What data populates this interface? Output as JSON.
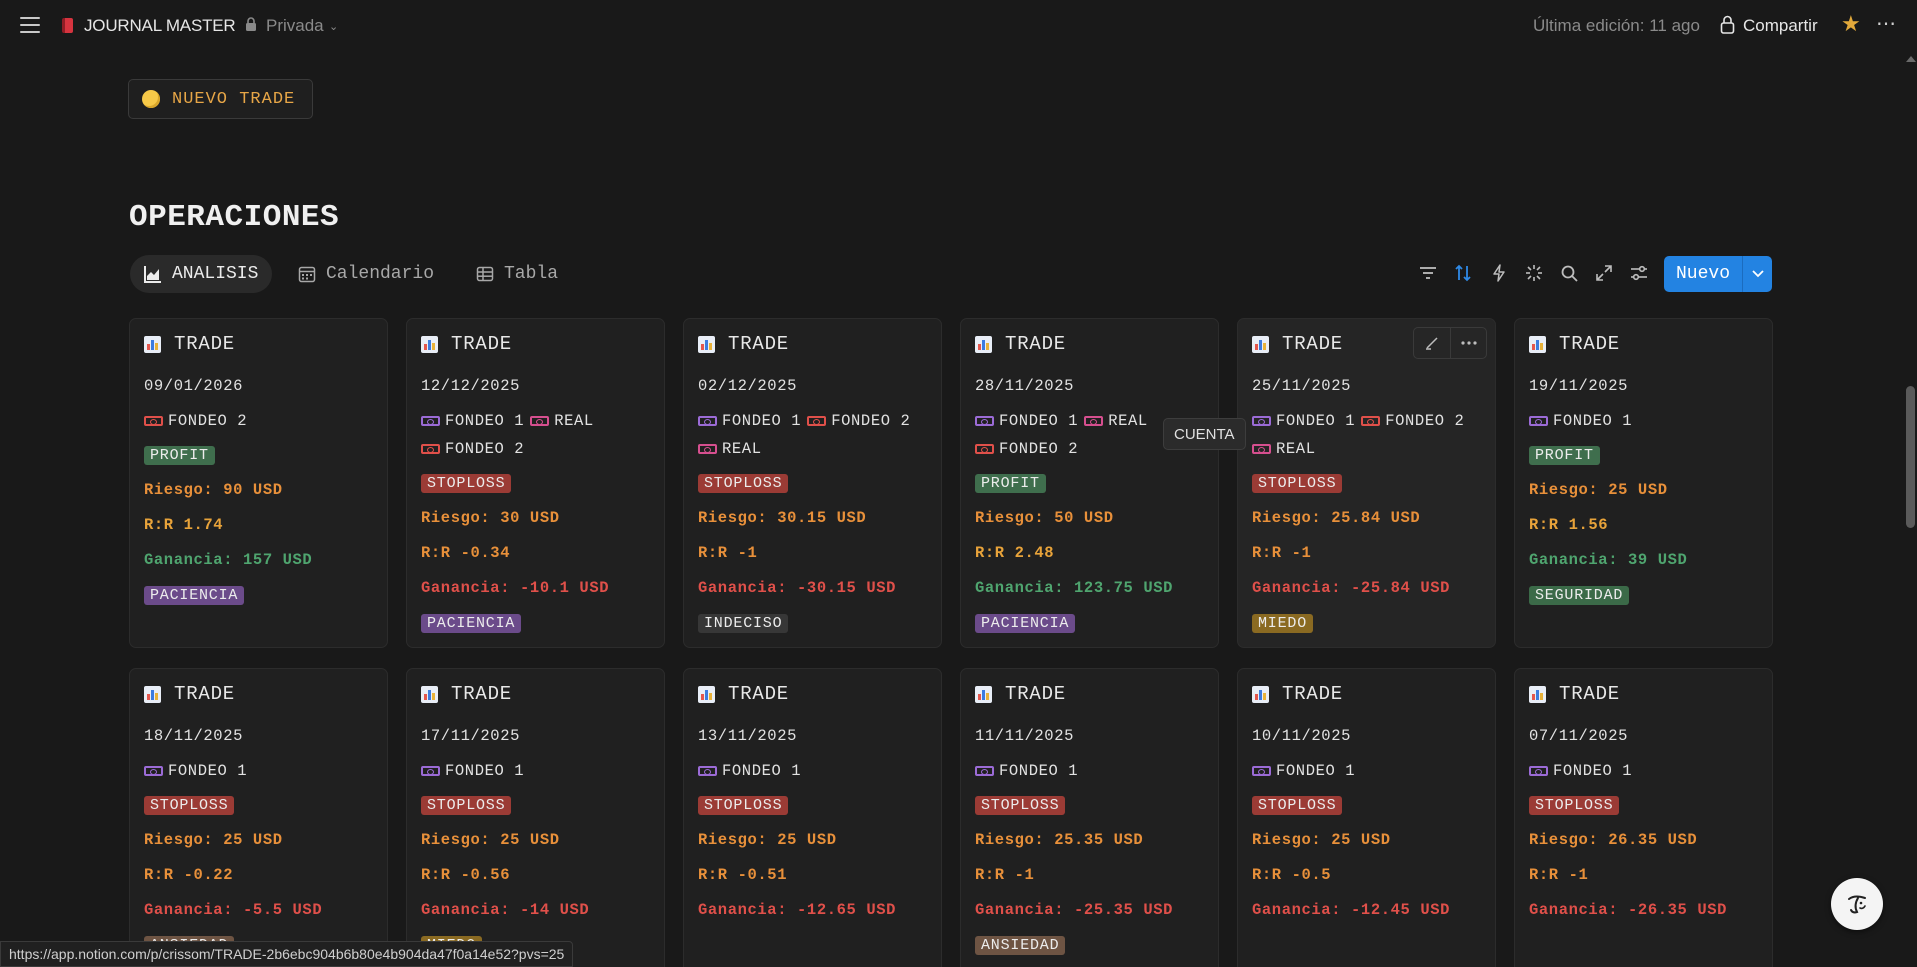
{
  "topbar": {
    "title": "JOURNAL MASTER",
    "privacy": "Privada",
    "last_edit": "Última edición: 11 ago",
    "share": "Compartir"
  },
  "new_trade_button": "NUEVO TRADE",
  "section_title": "OPERACIONES",
  "tabs": [
    {
      "label": "ANALISIS",
      "active": true
    },
    {
      "label": "Calendario",
      "active": false
    },
    {
      "label": "Tabla",
      "active": false
    }
  ],
  "toolbar": {
    "new_label": "Nuevo"
  },
  "tooltip": "CUENTA",
  "status_url": "https://app.notion.com/p/crissom/TRADE-2b6ebc904b6b80e4b904da47f0a14e52?pvs=25",
  "colors": {
    "profit": "#3f6e4d",
    "stoploss": "#9b3b35",
    "paciencia": "#6b4b8a",
    "indeciso": "#373737",
    "miedo": "#8a6a22",
    "seguridad": "#3b6a48",
    "ansiedad": "#6e5443",
    "account_purple": "#9b6bd6",
    "account_red": "#e0504a",
    "account_pink": "#d64f8f",
    "accent_blue": "#2383e2"
  },
  "cards": [
    {
      "title": "TRADE",
      "date": "09/01/2026",
      "accounts": [
        {
          "name": "FONDEO 2",
          "color": "red"
        }
      ],
      "result": "PROFIT",
      "riesgo": "Riesgo: 90 USD",
      "rr": "R:R 1.74",
      "ganancia": "Ganancia: 157 USD",
      "gain_positive": true,
      "emotion": "PACIENCIA"
    },
    {
      "title": "TRADE",
      "date": "12/12/2025",
      "accounts": [
        {
          "name": "FONDEO 1",
          "color": "purple"
        },
        {
          "name": "REAL",
          "color": "pink"
        },
        {
          "name": "FONDEO 2",
          "color": "red"
        }
      ],
      "result": "STOPLOSS",
      "riesgo": "Riesgo: 30 USD",
      "rr": "R:R -0.34",
      "ganancia": "Ganancia: -10.1 USD",
      "gain_positive": false,
      "emotion": "PACIENCIA"
    },
    {
      "title": "TRADE",
      "date": "02/12/2025",
      "accounts": [
        {
          "name": "FONDEO 1",
          "color": "purple"
        },
        {
          "name": "FONDEO 2",
          "color": "red"
        },
        {
          "name": "REAL",
          "color": "pink"
        }
      ],
      "result": "STOPLOSS",
      "riesgo": "Riesgo: 30.15 USD",
      "rr": "R:R -1",
      "ganancia": "Ganancia: -30.15 USD",
      "gain_positive": false,
      "emotion": "INDECISO"
    },
    {
      "title": "TRADE",
      "date": "28/11/2025",
      "accounts": [
        {
          "name": "FONDEO 1",
          "color": "purple"
        },
        {
          "name": "REAL",
          "color": "pink"
        },
        {
          "name": "FONDEO 2",
          "color": "red"
        }
      ],
      "result": "PROFIT",
      "riesgo": "Riesgo: 50 USD",
      "rr": "R:R 2.48",
      "ganancia": "Ganancia: 123.75 USD",
      "gain_positive": true,
      "emotion": "PACIENCIA"
    },
    {
      "title": "TRADE",
      "date": "25/11/2025",
      "accounts": [
        {
          "name": "FONDEO 1",
          "color": "purple"
        },
        {
          "name": "FONDEO 2",
          "color": "red"
        },
        {
          "name": "REAL",
          "color": "pink"
        }
      ],
      "result": "STOPLOSS",
      "riesgo": "Riesgo: 25.84 USD",
      "rr": "R:R -1",
      "ganancia": "Ganancia: -25.84 USD",
      "gain_positive": false,
      "emotion": "MIEDO"
    },
    {
      "title": "TRADE",
      "date": "19/11/2025",
      "accounts": [
        {
          "name": "FONDEO 1",
          "color": "purple"
        }
      ],
      "result": "PROFIT",
      "riesgo": "Riesgo: 25 USD",
      "rr": "R:R 1.56",
      "ganancia": "Ganancia: 39 USD",
      "gain_positive": true,
      "emotion": "SEGURIDAD"
    },
    {
      "title": "TRADE",
      "date": "18/11/2025",
      "accounts": [
        {
          "name": "FONDEO 1",
          "color": "purple"
        }
      ],
      "result": "STOPLOSS",
      "riesgo": "Riesgo: 25 USD",
      "rr": "R:R -0.22",
      "ganancia": "Ganancia: -5.5 USD",
      "gain_positive": false,
      "emotion": "ANSIEDAD"
    },
    {
      "title": "TRADE",
      "date": "17/11/2025",
      "accounts": [
        {
          "name": "FONDEO 1",
          "color": "purple"
        }
      ],
      "result": "STOPLOSS",
      "riesgo": "Riesgo: 25 USD",
      "rr": "R:R -0.56",
      "ganancia": "Ganancia: -14 USD",
      "gain_positive": false,
      "emotion": "MIEDO"
    },
    {
      "title": "TRADE",
      "date": "13/11/2025",
      "accounts": [
        {
          "name": "FONDEO 1",
          "color": "purple"
        }
      ],
      "result": "STOPLOSS",
      "riesgo": "Riesgo: 25 USD",
      "rr": "R:R -0.51",
      "ganancia": "Ganancia: -12.65 USD",
      "gain_positive": false,
      "emotion": ""
    },
    {
      "title": "TRADE",
      "date": "11/11/2025",
      "accounts": [
        {
          "name": "FONDEO 1",
          "color": "purple"
        }
      ],
      "result": "STOPLOSS",
      "riesgo": "Riesgo: 25.35 USD",
      "rr": "R:R -1",
      "ganancia": "Ganancia: -25.35 USD",
      "gain_positive": false,
      "emotion": "ANSIEDAD"
    },
    {
      "title": "TRADE",
      "date": "10/11/2025",
      "accounts": [
        {
          "name": "FONDEO 1",
          "color": "purple"
        }
      ],
      "result": "STOPLOSS",
      "riesgo": "Riesgo: 25 USD",
      "rr": "R:R -0.5",
      "ganancia": "Ganancia: -12.45 USD",
      "gain_positive": false,
      "emotion": ""
    },
    {
      "title": "TRADE",
      "date": "07/11/2025",
      "accounts": [
        {
          "name": "FONDEO 1",
          "color": "purple"
        }
      ],
      "result": "STOPLOSS",
      "riesgo": "Riesgo: 26.35 USD",
      "rr": "R:R -1",
      "ganancia": "Ganancia: -26.35 USD",
      "gain_positive": false,
      "emotion": ""
    }
  ]
}
